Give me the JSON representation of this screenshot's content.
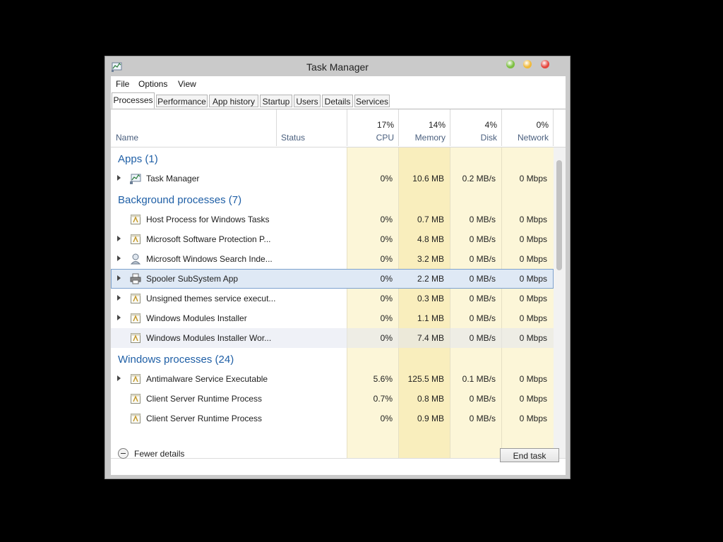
{
  "window": {
    "title": "Task Manager"
  },
  "titlebar_buttons": [
    {
      "name": "minimize",
      "color": "#7bbf3f"
    },
    {
      "name": "maximize",
      "color": "#f0b93a"
    },
    {
      "name": "close",
      "color": "#e5463e"
    }
  ],
  "menu": [
    "File",
    "Options",
    "View"
  ],
  "tabs": [
    "Processes",
    "Performance",
    "App history",
    "Startup",
    "Users",
    "Details",
    "Services"
  ],
  "active_tab": "Processes",
  "columns": {
    "name": "Name",
    "status": "Status",
    "cpu": {
      "label": "CPU",
      "pct": "17%"
    },
    "memory": {
      "label": "Memory",
      "pct": "14%"
    },
    "disk": {
      "label": "Disk",
      "pct": "4%"
    },
    "network": {
      "label": "Network",
      "pct": "0%"
    }
  },
  "groups": [
    {
      "title": "Apps (1)",
      "rows": [
        {
          "name": "Task Manager",
          "icon": "task-manager-icon",
          "expandable": true,
          "cpu": "0%",
          "memory": "10.6 MB",
          "disk": "0.2 MB/s",
          "network": "0 Mbps"
        }
      ]
    },
    {
      "title": "Background processes (7)",
      "rows": [
        {
          "name": "Host Process for Windows Tasks",
          "icon": "process-icon",
          "expandable": false,
          "cpu": "0%",
          "memory": "0.7 MB",
          "disk": "0 MB/s",
          "network": "0 Mbps"
        },
        {
          "name": "Microsoft Software Protection P...",
          "icon": "process-icon",
          "expandable": true,
          "cpu": "0%",
          "memory": "4.8 MB",
          "disk": "0 MB/s",
          "network": "0 Mbps"
        },
        {
          "name": "Microsoft Windows Search Inde...",
          "icon": "search-indexer-icon",
          "expandable": true,
          "cpu": "0%",
          "memory": "3.2 MB",
          "disk": "0 MB/s",
          "network": "0 Mbps"
        },
        {
          "name": "Spooler SubSystem App",
          "icon": "printer-icon",
          "expandable": true,
          "selected": true,
          "cpu": "0%",
          "memory": "2.2 MB",
          "disk": "0 MB/s",
          "network": "0 Mbps"
        },
        {
          "name": "Unsigned themes service execut...",
          "icon": "process-icon",
          "expandable": true,
          "cpu": "0%",
          "memory": "0.3 MB",
          "disk": "0 MB/s",
          "network": "0 Mbps"
        },
        {
          "name": "Windows Modules Installer",
          "icon": "process-icon",
          "expandable": true,
          "cpu": "0%",
          "memory": "1.1 MB",
          "disk": "0 MB/s",
          "network": "0 Mbps"
        },
        {
          "name": "Windows Modules Installer Wor...",
          "icon": "process-icon",
          "expandable": false,
          "hover": true,
          "cpu": "0%",
          "memory": "7.4 MB",
          "disk": "0 MB/s",
          "network": "0 Mbps"
        }
      ]
    },
    {
      "title": "Windows processes (24)",
      "rows": [
        {
          "name": "Antimalware Service Executable",
          "icon": "process-icon",
          "expandable": true,
          "cpu": "5.6%",
          "memory": "125.5 MB",
          "disk": "0.1 MB/s",
          "network": "0 Mbps"
        },
        {
          "name": "Client Server Runtime Process",
          "icon": "process-icon",
          "expandable": false,
          "cpu": "0.7%",
          "memory": "0.8 MB",
          "disk": "0 MB/s",
          "network": "0 Mbps"
        },
        {
          "name": "Client Server Runtime Process",
          "icon": "process-icon",
          "expandable": false,
          "cpu": "0%",
          "memory": "0.9 MB",
          "disk": "0 MB/s",
          "network": "0 Mbps"
        }
      ]
    }
  ],
  "footer": {
    "fewer_details": "Fewer details",
    "end_task": "End task"
  },
  "colors": {
    "heat_light": "#fcf6d8",
    "heat_medium": "#f9eebd",
    "group_title": "#1f5fa6"
  }
}
